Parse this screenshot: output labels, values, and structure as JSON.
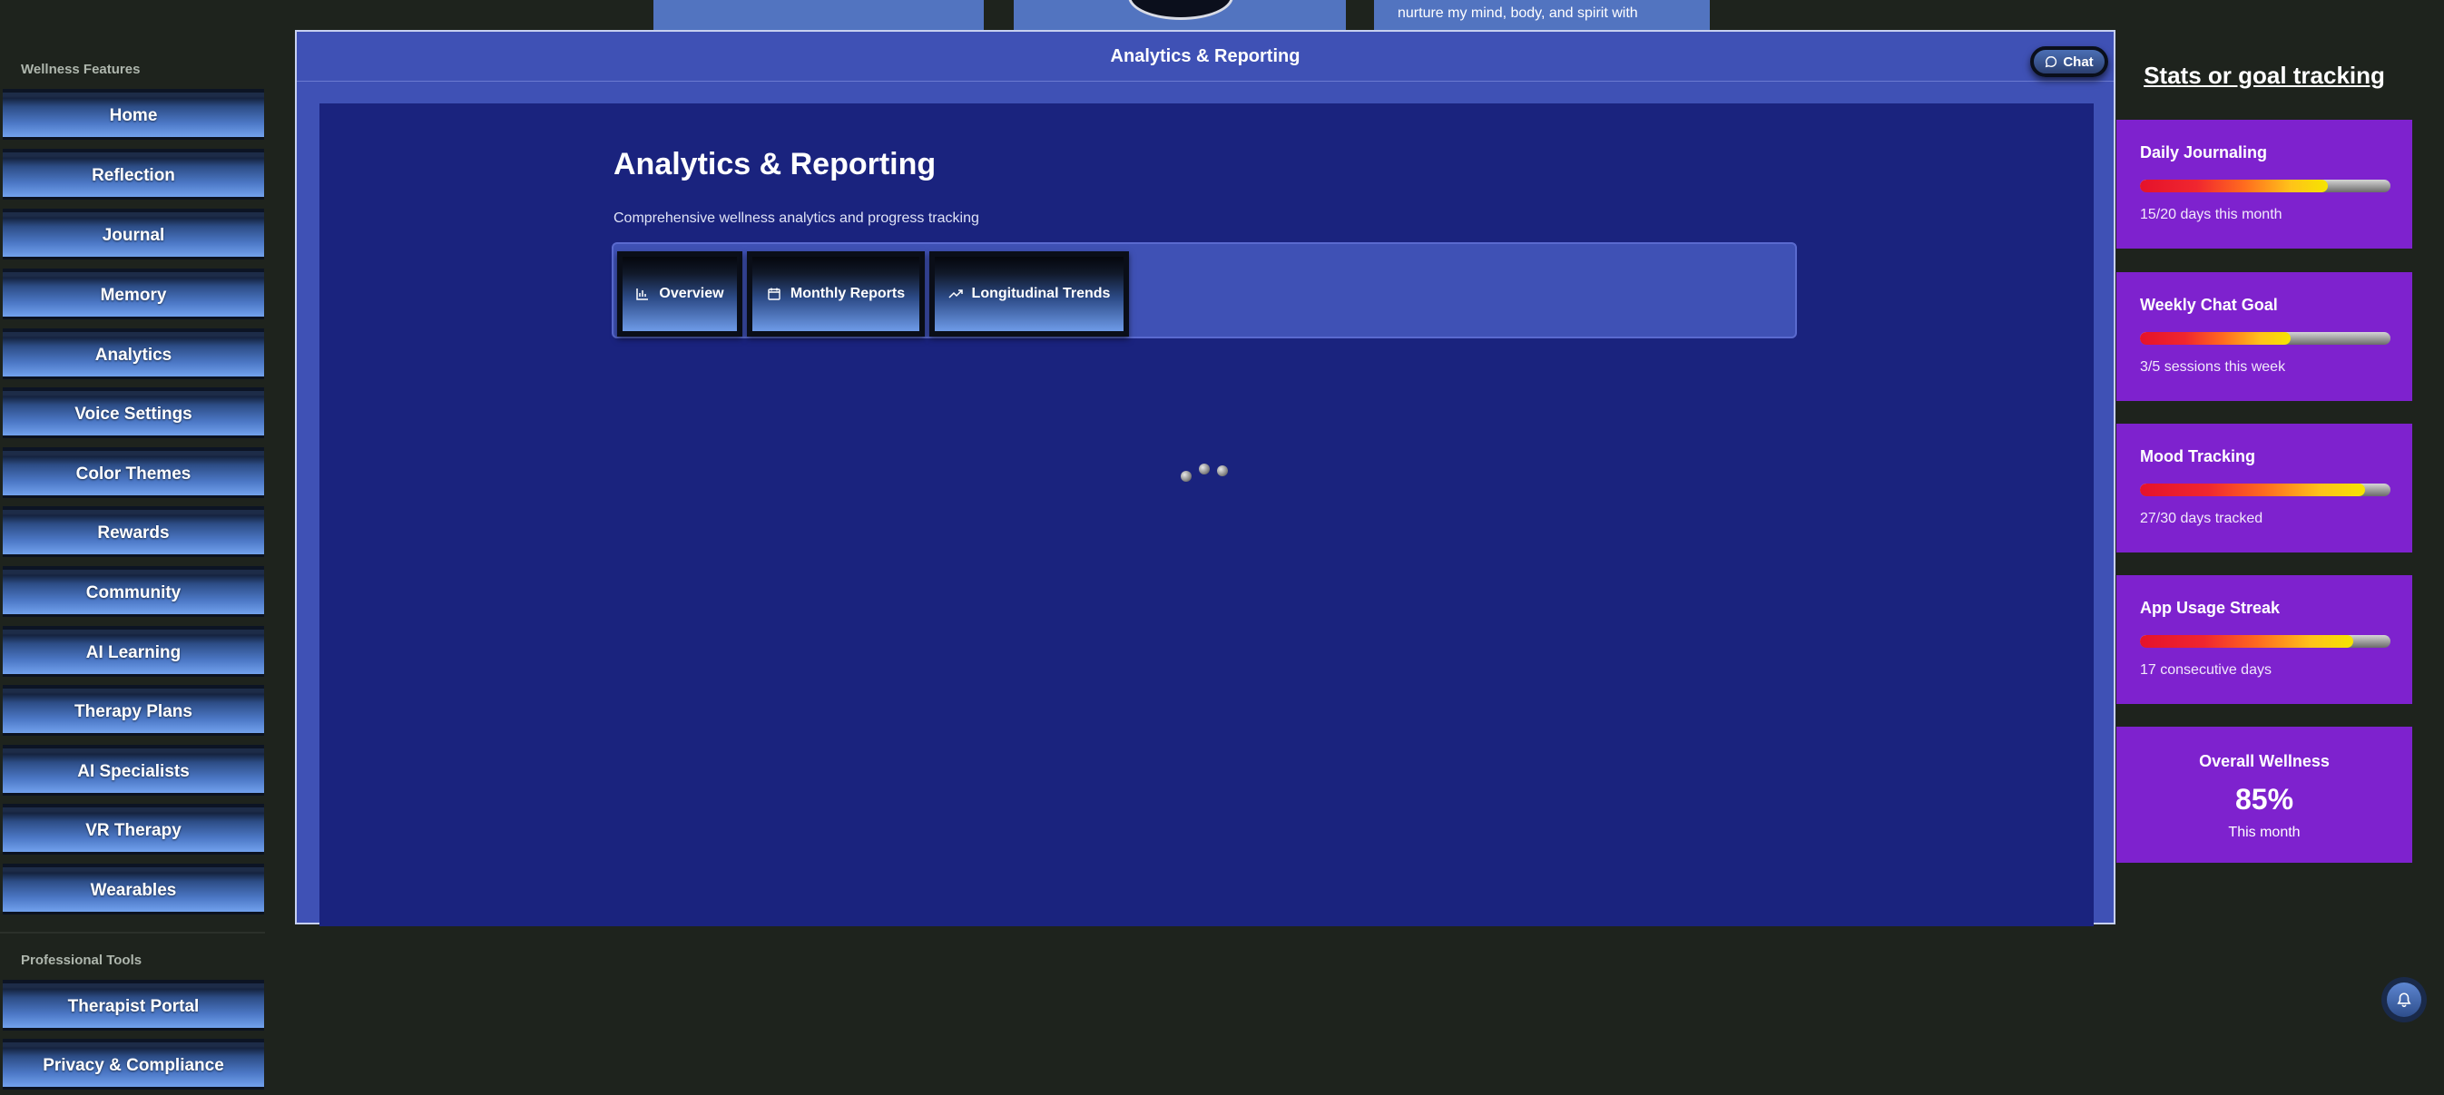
{
  "sidebar": {
    "wellness_title": "Wellness Features",
    "wellness_items": [
      "Home",
      "Reflection",
      "Journal",
      "Memory",
      "Analytics",
      "Voice Settings",
      "Color Themes",
      "Rewards",
      "Community",
      "AI Learning",
      "Therapy Plans",
      "AI Specialists",
      "VR Therapy",
      "Wearables"
    ],
    "pro_title": "Professional Tools",
    "pro_items": [
      "Therapist Portal",
      "Privacy & Compliance"
    ]
  },
  "background": {
    "peek_text": "nurture my mind, body, and spirit with"
  },
  "modal": {
    "header_title": "Analytics & Reporting",
    "chat_label": "Chat",
    "heading": "Analytics & Reporting",
    "subtitle": "Comprehensive wellness analytics and progress tracking",
    "tabs": [
      {
        "label": "Overview",
        "icon": "bar-chart-icon"
      },
      {
        "label": "Monthly Reports",
        "icon": "calendar-icon"
      },
      {
        "label": "Longitudinal Trends",
        "icon": "trending-up-icon"
      }
    ]
  },
  "stats": {
    "title": "Stats or goal tracking",
    "cards": [
      {
        "label": "Daily Journaling",
        "sub": "15/20 days this month",
        "progress": 0.75
      },
      {
        "label": "Weekly Chat Goal",
        "sub": "3/5 sessions this week",
        "progress": 0.6
      },
      {
        "label": "Mood Tracking",
        "sub": "27/30 days tracked",
        "progress": 0.9
      },
      {
        "label": "App Usage Streak",
        "sub": "17 consecutive days",
        "progress": 0.85
      }
    ],
    "overall": {
      "title": "Overall Wellness",
      "value": "85%",
      "sub": "This month"
    }
  },
  "colors": {
    "card": "#7e22ce",
    "modal": "#3f51b5",
    "modal_body": "#1a237e"
  }
}
